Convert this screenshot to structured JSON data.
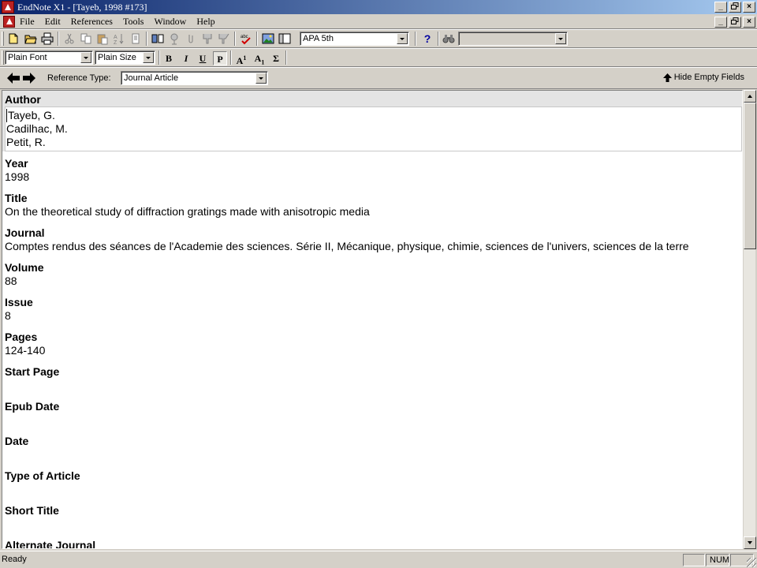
{
  "window": {
    "title": "EndNote X1 - [Tayeb, 1998 #173]",
    "minimize_glyph": "_",
    "restore_glyph": "🗗",
    "close_glyph": "×"
  },
  "menu": {
    "items": [
      "File",
      "Edit",
      "References",
      "Tools",
      "Window",
      "Help"
    ],
    "underline_keys": [
      "F",
      "E",
      "R",
      "T",
      "W",
      "H"
    ]
  },
  "toolbar": {
    "style_value": "APA 5th",
    "help_glyph": "?",
    "search_value": ""
  },
  "format": {
    "font_value": "Plain Font",
    "size_value": "Plain Size",
    "bold": "B",
    "italic": "I",
    "underline": "U",
    "plain": "P",
    "superscript": "A",
    "superscript_mark": "1",
    "subscript": "A",
    "subscript_mark": "1",
    "symbol": "Σ"
  },
  "reference": {
    "type_label": "Reference Type:",
    "type_value": "Journal Article",
    "hide_empty_label": "Hide Empty Fields"
  },
  "fields": {
    "author": {
      "label": "Author",
      "values": [
        "Tayeb, G.",
        "Cadilhac, M.",
        "Petit, R."
      ]
    },
    "year": {
      "label": "Year",
      "value": "1998"
    },
    "title": {
      "label": "Title",
      "value": "On the theoretical study of diffraction gratings made with anisotropic media"
    },
    "journal": {
      "label": "Journal",
      "value": "Comptes rendus des séances de l'Academie des sciences. Série II, Mécanique, physique, chimie, sciences de l'univers, sciences de la terre"
    },
    "volume": {
      "label": "Volume",
      "value": "88"
    },
    "issue": {
      "label": "Issue",
      "value": "8"
    },
    "pages": {
      "label": "Pages",
      "value": "124-140"
    },
    "start_page": {
      "label": "Start Page",
      "value": ""
    },
    "epub_date": {
      "label": "Epub Date",
      "value": ""
    },
    "date": {
      "label": "Date",
      "value": ""
    },
    "type_of_article": {
      "label": "Type of Article",
      "value": ""
    },
    "short_title": {
      "label": "Short Title",
      "value": ""
    },
    "alternate_journal": {
      "label": "Alternate Journal",
      "value": ""
    }
  },
  "status": {
    "text": "Ready",
    "num": "NUM"
  },
  "colors": {
    "title_active": "#0a246a",
    "title_gradient_end": "#a6caf0",
    "face": "#d4d0c8",
    "app_icon": "#b22222"
  }
}
